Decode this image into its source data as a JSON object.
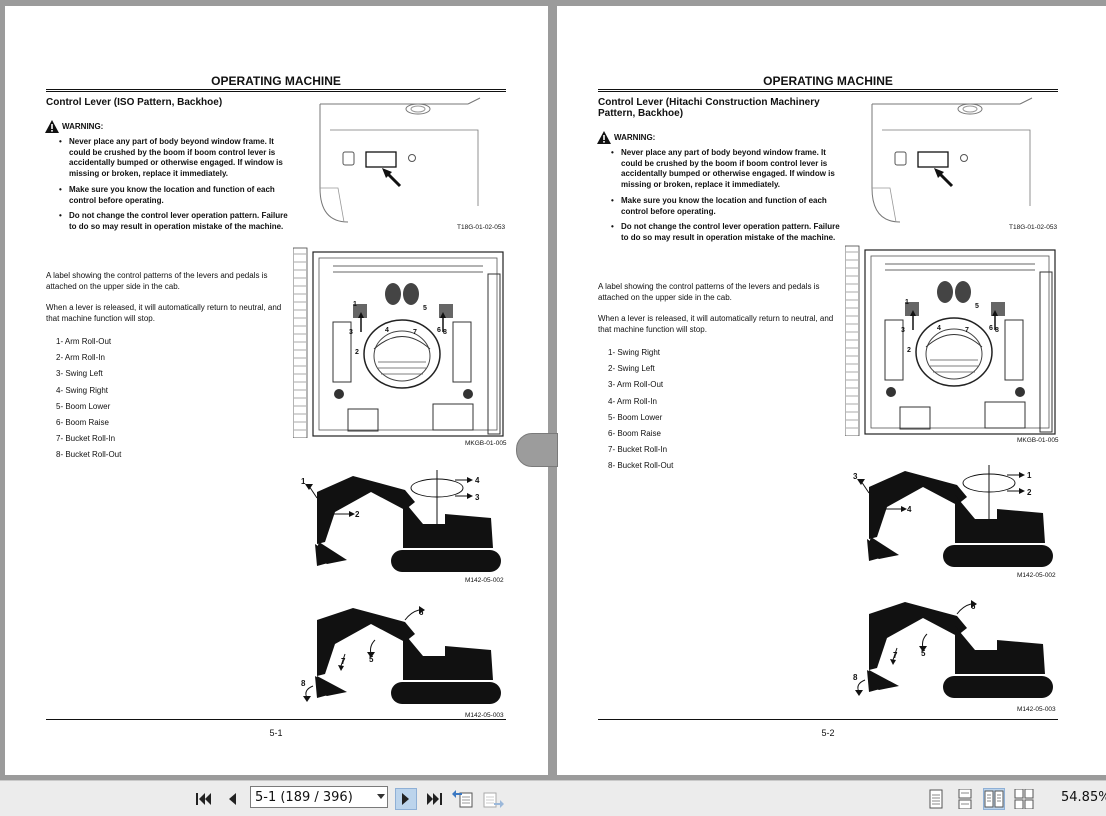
{
  "viewer": {
    "page_select_value": "5-1 (189 / 396)",
    "zoom": "54.85%"
  },
  "pages": [
    {
      "header": "OPERATING MACHINE",
      "section_title": "Control Lever (ISO Pattern, Backhoe)",
      "warning_label": "WARNING:",
      "warnings": [
        "Never place any part of body beyond window frame. It could be crushed by the boom if boom control lever is accidentally bumped or otherwise engaged. If window is missing or broken, replace it immediately.",
        "Make sure you know the location and function of each control before operating.",
        "Do not change the control lever operation pattern. Failure to do so may result in operation mistake of the machine."
      ],
      "para1": "A label showing the control patterns of the levers and pedals is attached on the upper side in the cab.",
      "para2": "When a lever is released, it will automatically return to neutral, and that machine function will stop.",
      "operations": [
        "1-  Arm Roll-Out",
        "2-  Arm Roll-In",
        "3-  Swing Left",
        "4-  Swing Right",
        "5-  Boom Lower",
        "6-  Boom Raise",
        "7-  Bucket Roll-In",
        "8-  Bucket Roll-Out"
      ],
      "fig_codes": [
        "T18G-01-02-053",
        "MKGB-01-005",
        "M142-05-002",
        "M142-05-003"
      ],
      "fig1_labels": [
        "1",
        "2",
        "3",
        "4",
        "5",
        "6",
        "7",
        "8"
      ],
      "fig2_labels": [
        "1",
        "2",
        "3",
        "4"
      ],
      "fig3_labels": [
        "5",
        "6",
        "7",
        "8"
      ],
      "page_number": "5-1"
    },
    {
      "header": "OPERATING MACHINE",
      "section_title": "Control Lever (Hitachi Construction Machinery Pattern, Backhoe)",
      "warning_label": "WARNING:",
      "warnings": [
        "Never place any part of body beyond window frame. It could be crushed by the boom if boom control lever is accidentally bumped or otherwise engaged. If window is missing or broken, replace it immediately.",
        "Make sure you know the location and function of each control before operating.",
        "Do not change the control lever operation pattern. Failure to do so may result in operation mistake of the machine."
      ],
      "para1": "A label showing the control patterns of the levers and pedals is attached on the upper side in the cab.",
      "para2": "When a lever is released, it will automatically return to neutral, and that machine function will stop.",
      "operations": [
        "1-  Swing Right",
        "2-  Swing Left",
        "3-  Arm Roll-Out",
        "4-  Arm Roll-In",
        "5-  Boom Lower",
        "6-  Boom Raise",
        "7-  Bucket Roll-In",
        "8-  Bucket Roll-Out"
      ],
      "fig_codes": [
        "T18G-01-02-053",
        "MKGB-01-005",
        "M142-05-002",
        "M142-05-003"
      ],
      "fig1_labels": [
        "1",
        "2",
        "3",
        "4",
        "5",
        "6",
        "7",
        "8"
      ],
      "fig2_labels": [
        "3",
        "4",
        "1",
        "2"
      ],
      "fig3_labels": [
        "5",
        "6",
        "7",
        "8"
      ],
      "page_number": "5-2"
    }
  ],
  "icons": [
    "first-page-icon",
    "prev-page-icon",
    "next-page-icon",
    "last-page-icon",
    "go-back-icon",
    "go-forward-icon",
    "single-page-icon",
    "continuous-icon",
    "facing-icon",
    "continuous-facing-icon"
  ]
}
